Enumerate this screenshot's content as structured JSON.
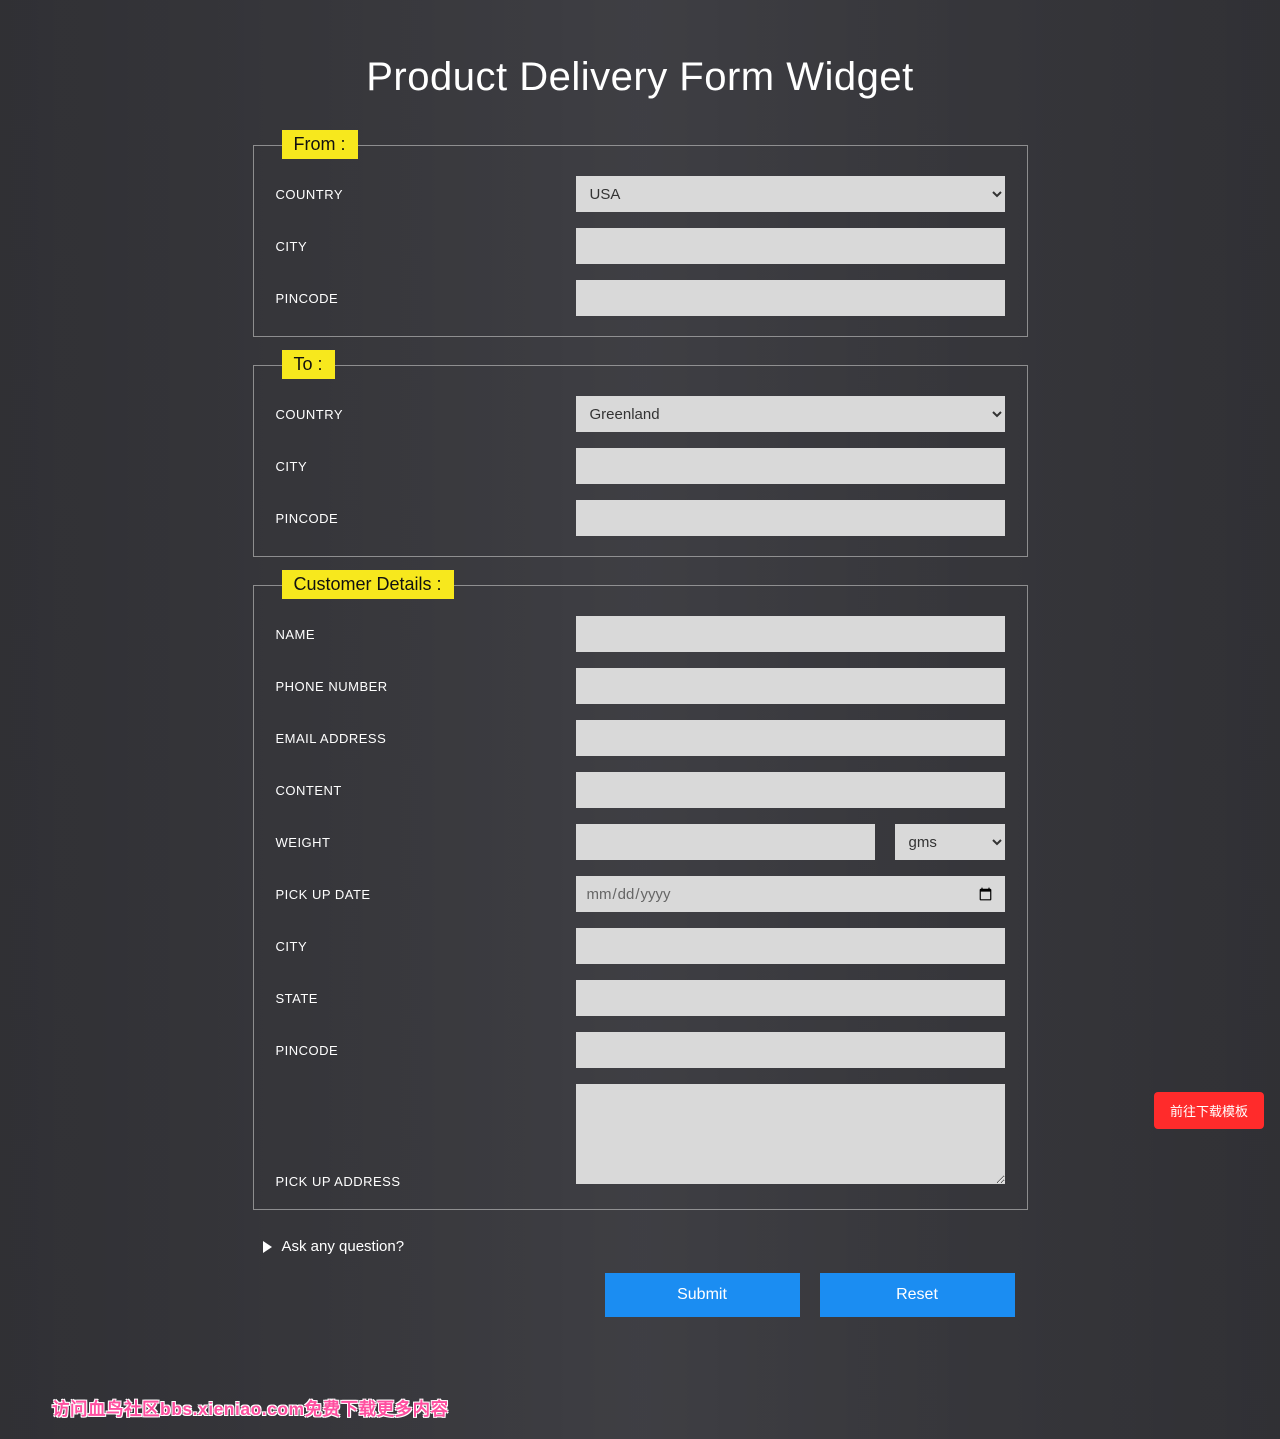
{
  "title": "Product Delivery Form Widget",
  "from": {
    "legend": "From :",
    "country_label": "COUNTRY",
    "country_value": "USA",
    "country_options": [
      "USA"
    ],
    "city_label": "CITY",
    "pincode_label": "PINCODE"
  },
  "to": {
    "legend": "To :",
    "country_label": "COUNTRY",
    "country_value": "Greenland",
    "country_options": [
      "Greenland"
    ],
    "city_label": "CITY",
    "pincode_label": "PINCODE"
  },
  "customer": {
    "legend": "Customer Details :",
    "name_label": "NAME",
    "phone_label": "PHONE NUMBER",
    "email_label": "EMAIL ADDRESS",
    "content_label": "CONTENT",
    "weight_label": "WEIGHT",
    "weight_unit": "gms",
    "weight_options": [
      "gms"
    ],
    "pickup_date_label": "PICK UP DATE",
    "pickup_date_placeholder": "mm/dd/yyyy",
    "city_label": "CITY",
    "state_label": "STATE",
    "pincode_label": "PINCODE",
    "pickup_address_label": "PICK UP ADDRESS"
  },
  "ask_question": "Ask any question?",
  "buttons": {
    "submit": "Submit",
    "reset": "Reset"
  },
  "download_button": "前往下载模板",
  "footer": "访问血鸟社区bbs.xieniao.com免费下载更多内容"
}
